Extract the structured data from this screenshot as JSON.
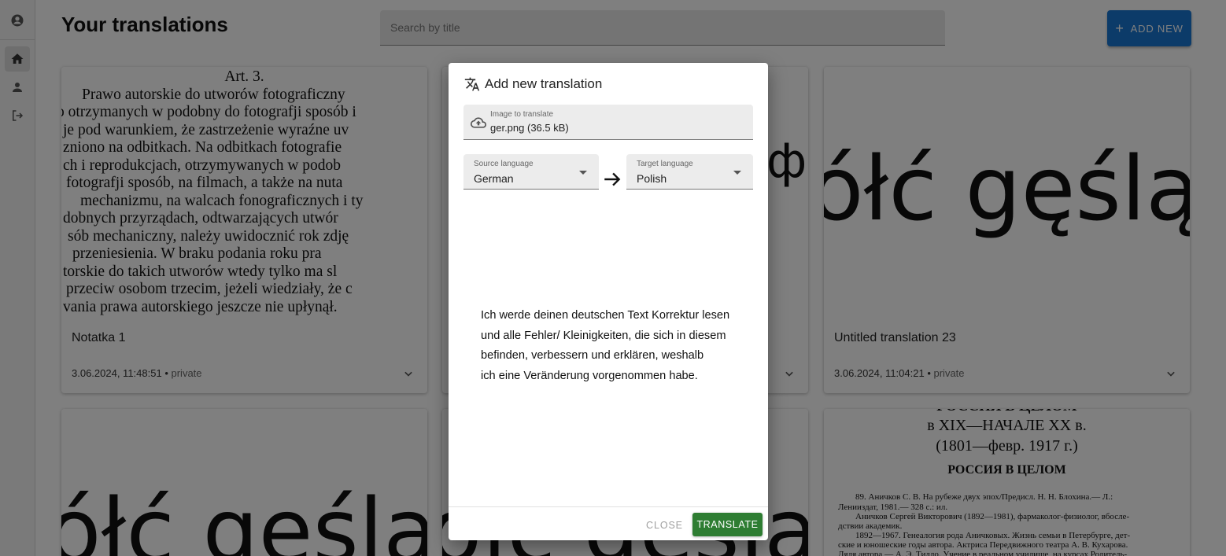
{
  "page": {
    "title": "Your translations"
  },
  "search": {
    "placeholder": "Search by title"
  },
  "add_button": {
    "label": "ADD NEW"
  },
  "sidebar": {
    "items": [
      {
        "icon": "account-circle-icon"
      },
      {
        "icon": "home-icon",
        "active": true
      },
      {
        "icon": "person-icon"
      },
      {
        "icon": "logout-icon"
      }
    ]
  },
  "cards": [
    {
      "title": "Notatka 1",
      "date": "3.06.2024, 11:48:51",
      "visibility": "private",
      "image_lines": [
        "Art. 3.",
        "Prawo autorskie do utworów  fotograficzny",
        "o otrzymanych w podobny do fotografji sposób i",
        "je pod warunkiem, że zastrzeżenie wyraźne uv",
        "zniono na odbitkach. Na odbitkach fotografie",
        "ch i reprodukcjach, otrzymywanych w podob",
        "fotografji sposób, na filmach, a także na nuta",
        "mechanizmu, na walcach fonograficznych i ty",
        "dobnych przyrządach,  odtwarzających  utwór",
        "sób mechaniczny, należy uwidocznić rok zdję",
        "przeniesienia.  W braku podania roku pra",
        "torskie do takich utworów wtedy tylko ma sl",
        "przeciw osobom trzecim, jeżeli wiedziały, że c",
        "vania prawa autorskiego jeszcze nie upłynął."
      ]
    },
    {
      "image_fragment": "фа"
    },
    {
      "title": "Untitled translation 23",
      "date": "3.06.2024, 11:04:21",
      "visibility": "private",
      "image_text": "ółć gęślą j"
    },
    {
      "image_text": "ółć gęślą j"
    },
    {
      "image_text": "ółć gęślą j"
    },
    {
      "image_lines": [
        "РОССИЯ В ЦЕЛОМ",
        "в XIX—НАЧАЛЕ XX в.",
        "(1801—февр. 1917 г.)",
        "РОССИЯ В ЦЕЛОМ",
        "89. Аничков С. В. На рубеже двух эпох/Предисл. Н. Н. Блохина.— Л.:",
        "Ленииздат, 1981.— 328 с.: ил.",
        "Аничков Сергей Викторович (1892—1981), фармаколог-физиолог, вбосле-",
        "дствии академик.",
        "1892—1967. Генеалогия рода Аничковых. Жизнь семьи в Петербурге, дет-",
        "ские и юношеские годы автора. Актриса Передвижного театра А. В. Кухарова.",
        "Дядя автора — А. Э. Тилло. Учение в реальном училище, на курсах Родитель-"
      ]
    }
  ],
  "dialog": {
    "title": "Add new translation",
    "title_icon": "translate-icon",
    "file_field": {
      "label": "Image to translate",
      "value": "ger.png (36.5 kB)",
      "icon": "cloud-upload-icon"
    },
    "source": {
      "label": "Source language",
      "value": "German"
    },
    "target": {
      "label": "Target language",
      "value": "Polish"
    },
    "arrow_icon": "arrow-right-icon",
    "preview_text": "Ich werde deinen deutschen Text Korrektur lesen\nund alle Fehler/ Kleinigkeiten, die sich in diesem\nbefinden, verbessern und erklären, weshalb\nich eine Veränderung vorgenommen habe.",
    "close_label": "CLOSE",
    "translate_label": "TRANSLATE"
  },
  "colors": {
    "primary": "#1976d2",
    "success": "#2e7d32",
    "overlay": "rgba(0,0,0,0.5)"
  }
}
